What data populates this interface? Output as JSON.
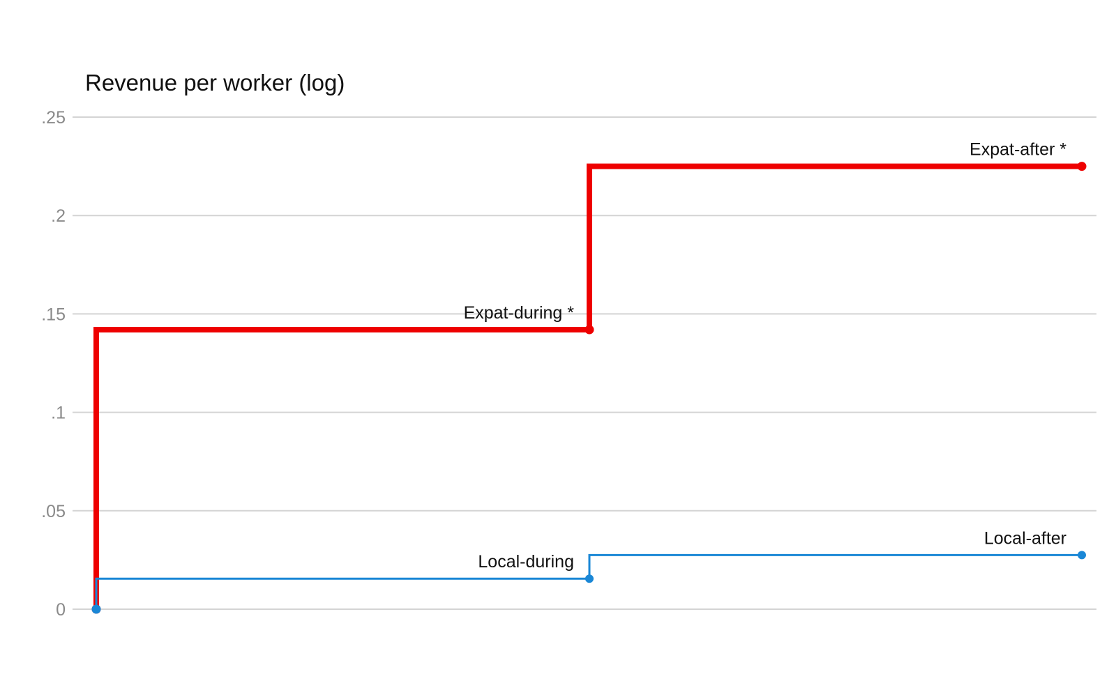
{
  "chart_data": {
    "type": "line",
    "title": "Revenue per worker (log)",
    "xlabel": "",
    "ylabel": "",
    "ylim": [
      0,
      0.25
    ],
    "yticks": [
      {
        "value": 0,
        "label": "0"
      },
      {
        "value": 0.05,
        "label": ".05"
      },
      {
        "value": 0.1,
        "label": ".1"
      },
      {
        "value": 0.15,
        "label": ".15"
      },
      {
        "value": 0.2,
        "label": ".2"
      },
      {
        "value": 0.25,
        "label": ".25"
      }
    ],
    "x": [
      0,
      1,
      2
    ],
    "step": "horizontal-then-vertical at each point",
    "grid": true,
    "legend": "none",
    "series": [
      {
        "color": "#ee0000",
        "style": "thick",
        "values": [
          0,
          0.142,
          0.225
        ],
        "point_labels": [
          "",
          "Expat-during *",
          "Expat-after *"
        ]
      },
      {
        "color": "#1a87d6",
        "style": "thin",
        "values": [
          0,
          0.0155,
          0.0275
        ],
        "point_labels": [
          "",
          "Local-during",
          "Local-after"
        ]
      }
    ]
  }
}
